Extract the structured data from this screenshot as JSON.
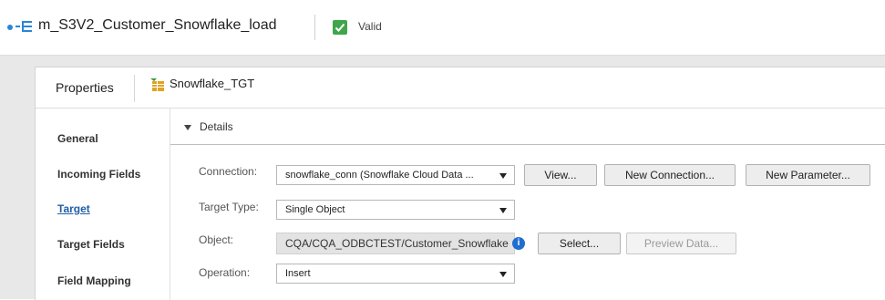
{
  "header": {
    "mapping_title": "m_S3V2_Customer_Snowflake_load",
    "status_label": "Valid",
    "colors": {
      "accent": "#2a86d9",
      "valid": "#3fa64a"
    }
  },
  "panel": {
    "properties_label": "Properties",
    "object_name": "Snowflake_TGT",
    "nav": [
      {
        "label": "General",
        "active": false
      },
      {
        "label": "Incoming Fields",
        "active": false
      },
      {
        "label": "Target",
        "active": true
      },
      {
        "label": "Target Fields",
        "active": false
      },
      {
        "label": "Field Mapping",
        "active": false
      }
    ],
    "details": {
      "section_title": "Details",
      "connection": {
        "label": "Connection:",
        "value": "snowflake_conn (Snowflake Cloud Data ...",
        "view_button": "View...",
        "new_connection_button": "New Connection...",
        "new_parameter_button": "New Parameter..."
      },
      "target_type": {
        "label": "Target Type:",
        "value": "Single Object"
      },
      "object": {
        "label": "Object:",
        "value": "CQA/CQA_ODBCTEST/Customer_Snowflake",
        "select_button": "Select...",
        "preview_button": "Preview Data..."
      },
      "operation": {
        "label": "Operation:",
        "value": "Insert"
      }
    }
  }
}
